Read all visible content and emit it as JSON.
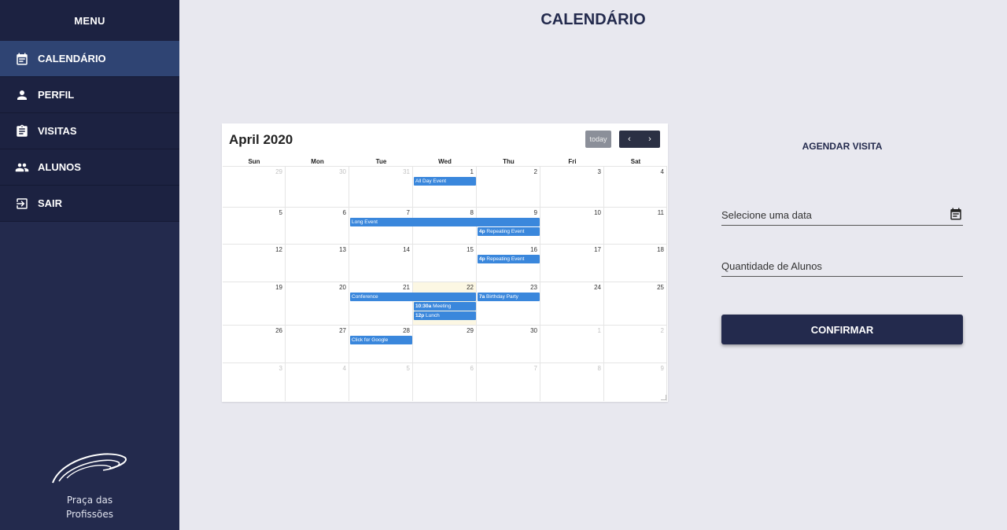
{
  "sidebar": {
    "menu_label": "MENU",
    "items": [
      {
        "label": "CALENDÁRIO",
        "icon": "calendar-icon",
        "active": true
      },
      {
        "label": "PERFIL",
        "icon": "person-icon",
        "active": false
      },
      {
        "label": "VISITAS",
        "icon": "clipboard-icon",
        "active": false
      },
      {
        "label": "ALUNOS",
        "icon": "group-icon",
        "active": false
      },
      {
        "label": "SAIR",
        "icon": "logout-icon",
        "active": false
      }
    ],
    "logo_line1": "Praça das",
    "logo_line2": "Profissões"
  },
  "page_title": "CALENDÁRIO",
  "calendar": {
    "month_title": "April 2020",
    "today_label": "today",
    "prev_label": "‹",
    "next_label": "›",
    "days_of_week": [
      "Sun",
      "Mon",
      "Tue",
      "Wed",
      "Thu",
      "Fri",
      "Sat"
    ],
    "weeks": [
      [
        {
          "d": "29",
          "o": true
        },
        {
          "d": "30",
          "o": true
        },
        {
          "d": "31",
          "o": true
        },
        {
          "d": "1"
        },
        {
          "d": "2"
        },
        {
          "d": "3"
        },
        {
          "d": "4"
        }
      ],
      [
        {
          "d": "5"
        },
        {
          "d": "6"
        },
        {
          "d": "7"
        },
        {
          "d": "8"
        },
        {
          "d": "9"
        },
        {
          "d": "10"
        },
        {
          "d": "11"
        }
      ],
      [
        {
          "d": "12"
        },
        {
          "d": "13"
        },
        {
          "d": "14"
        },
        {
          "d": "15"
        },
        {
          "d": "16"
        },
        {
          "d": "17"
        },
        {
          "d": "18"
        }
      ],
      [
        {
          "d": "19"
        },
        {
          "d": "20"
        },
        {
          "d": "21"
        },
        {
          "d": "22",
          "today": true
        },
        {
          "d": "23"
        },
        {
          "d": "24"
        },
        {
          "d": "25"
        }
      ],
      [
        {
          "d": "26"
        },
        {
          "d": "27"
        },
        {
          "d": "28"
        },
        {
          "d": "29"
        },
        {
          "d": "30"
        },
        {
          "d": "1",
          "o": true
        },
        {
          "d": "2",
          "o": true
        }
      ],
      [
        {
          "d": "3",
          "o": true
        },
        {
          "d": "4",
          "o": true
        },
        {
          "d": "5",
          "o": true
        },
        {
          "d": "6",
          "o": true
        },
        {
          "d": "7",
          "o": true
        },
        {
          "d": "8",
          "o": true
        },
        {
          "d": "9",
          "o": true
        }
      ]
    ],
    "events": [
      {
        "week": 0,
        "day": 3,
        "span": 1,
        "slot": 0,
        "time": "",
        "title": "All Day Event"
      },
      {
        "week": 1,
        "day": 2,
        "span": 3,
        "slot": 0,
        "time": "",
        "title": "Long Event"
      },
      {
        "week": 1,
        "day": 4,
        "span": 1,
        "slot": 1,
        "time": "4p",
        "title": "Repeating Event"
      },
      {
        "week": 2,
        "day": 4,
        "span": 1,
        "slot": 0,
        "time": "4p",
        "title": "Repeating Event"
      },
      {
        "week": 3,
        "day": 2,
        "span": 2,
        "slot": 0,
        "time": "",
        "title": "Conference"
      },
      {
        "week": 3,
        "day": 4,
        "span": 1,
        "slot": 0,
        "time": "7a",
        "title": "Birthday Party"
      },
      {
        "week": 3,
        "day": 3,
        "span": 1,
        "slot": 1,
        "time": "10:30a",
        "title": "Meeting"
      },
      {
        "week": 3,
        "day": 3,
        "span": 1,
        "slot": 2,
        "time": "12p",
        "title": "Lunch"
      },
      {
        "week": 4,
        "day": 2,
        "span": 1,
        "slot": 0,
        "time": "",
        "title": "Click for Google"
      }
    ],
    "event_color": "#3a87dc",
    "today_color": "#fcf7e3"
  },
  "form": {
    "title": "AGENDAR VISITA",
    "date_placeholder": "Selecione uma data",
    "students_placeholder": "Quantidade de Alunos",
    "confirm_label": "CONFIRMAR"
  },
  "colors": {
    "sidebar_bg": "#232a4d",
    "active_item": "#2f4473",
    "page_bg": "#e8e8ef",
    "accent": "#232a4d"
  }
}
